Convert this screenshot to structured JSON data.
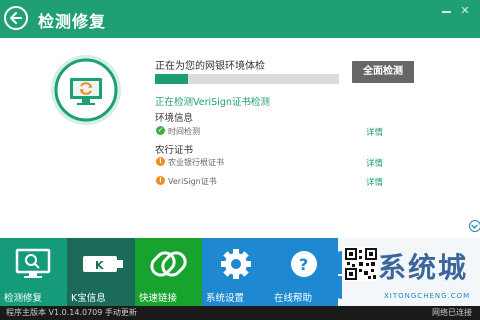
{
  "window": {
    "title": "检测修复"
  },
  "scan": {
    "status_text": "正在为您的网银环境体检",
    "progress": 0.18,
    "full_scan_label": "全面检测",
    "current_check": "正在检测VeriSign证书检测"
  },
  "env_section": {
    "title": "环境信息",
    "rows": [
      {
        "label": "时间检测",
        "state": "ok",
        "detail": "详情"
      }
    ]
  },
  "cert_section": {
    "title": "农行证书",
    "rows": [
      {
        "label": "农业银行根证书",
        "state": "warning",
        "detail": "详情"
      },
      {
        "label": "VeriSign证书",
        "state": "warning",
        "detail": "详情"
      }
    ]
  },
  "tabs": [
    {
      "label": "检测修复",
      "icon": "monitor-icon",
      "active": true
    },
    {
      "label": "K宝信息",
      "icon": "k-key-icon",
      "active": false
    },
    {
      "label": "快速链接",
      "icon": "link-icon",
      "active": false
    },
    {
      "label": "系统设置",
      "icon": "gear-icon",
      "active": false
    },
    {
      "label": "在线帮助",
      "icon": "help-icon",
      "active": false
    }
  ],
  "watermark": {
    "title": "系统城",
    "url": "XITONGCHENG.COM"
  },
  "statusbar": {
    "version": "程序主版本 V1.0.14.0709 手动更新",
    "network": "网络已连接"
  },
  "colors": {
    "brand_green": "#1f9f72",
    "warning_orange": "#f08a24",
    "ok_green": "#3fae49"
  }
}
